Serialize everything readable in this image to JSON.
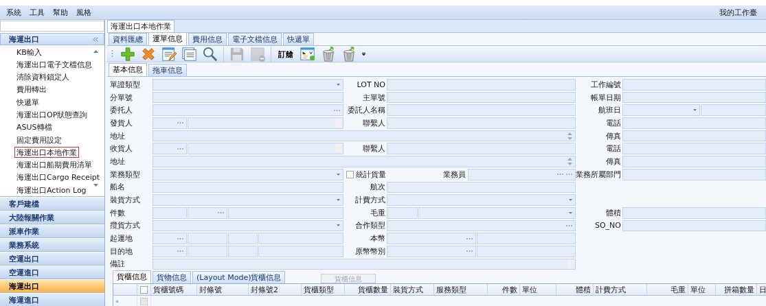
{
  "menu": [
    "系統",
    "工具",
    "幫助",
    "風格"
  ],
  "workbench": "我的工作臺",
  "sidebar": {
    "header": "海運出口",
    "items": [
      {
        "label": "KB輸入",
        "selected": false
      },
      {
        "label": "海運出口電子文檔信息",
        "selected": false
      },
      {
        "label": "清除資料鎖定人",
        "selected": false
      },
      {
        "label": "費用轉出",
        "selected": false
      },
      {
        "label": "快遞單",
        "selected": false
      },
      {
        "label": "海運出口OP狀態查詢",
        "selected": false
      },
      {
        "label": "ASUS轉檔",
        "selected": false
      },
      {
        "label": "固定費用設定",
        "selected": false
      },
      {
        "label": "海運出口本地作業",
        "selected": true
      },
      {
        "label": "海運出口船期費用清單",
        "selected": false
      },
      {
        "label": "海運出口Cargo Receipt",
        "selected": false
      },
      {
        "label": "海運出口Action Log",
        "selected": false
      }
    ],
    "groups": [
      {
        "label": "客戶建檔",
        "selected": false
      },
      {
        "label": "大陸報關作業",
        "selected": false
      },
      {
        "label": "派車作業",
        "selected": false
      },
      {
        "label": "業務系統",
        "selected": false
      },
      {
        "label": "空運出口",
        "selected": false
      },
      {
        "label": "空運進口",
        "selected": false
      },
      {
        "label": "海運出口",
        "selected": true
      },
      {
        "label": "海運進口",
        "selected": false
      }
    ]
  },
  "document_tab": "海運出口本地作業",
  "tabs": [
    {
      "label": "資料匯總",
      "selected": false
    },
    {
      "label": "運單信息",
      "selected": true
    },
    {
      "label": "費用信息",
      "selected": false
    },
    {
      "label": "電子文檔信息",
      "selected": false
    },
    {
      "label": "快遞單",
      "selected": false
    }
  ],
  "toolbar": [
    {
      "kind": "add",
      "disabled": false
    },
    {
      "kind": "delete",
      "disabled": false
    },
    {
      "kind": "edit",
      "disabled": false
    },
    {
      "kind": "list",
      "disabled": false
    },
    {
      "kind": "search",
      "disabled": false
    },
    {
      "kind": "save",
      "disabled": true
    },
    {
      "kind": "remove",
      "disabled": true
    },
    {
      "kind": "text",
      "label": "訂艙",
      "disabled": false
    },
    {
      "kind": "mail",
      "disabled": false
    },
    {
      "kind": "trash",
      "disabled": false
    },
    {
      "kind": "trash",
      "disabled": false
    }
  ],
  "subtabs": [
    {
      "label": "基本信息",
      "selected": true
    },
    {
      "label": "拖車信息",
      "selected": false
    }
  ],
  "form": [
    {
      "left": {
        "label": "單證類型",
        "segments": [
          {
            "kind": "combo"
          }
        ]
      },
      "middle": {
        "label": "LOT NO",
        "segments": [
          {
            "kind": "text"
          }
        ]
      },
      "right": {
        "label": "工作編號",
        "segments": [
          {
            "kind": "text"
          }
        ]
      }
    },
    {
      "left": {
        "label": "分單號",
        "segments": [
          {
            "kind": "text"
          }
        ]
      },
      "middle": {
        "label": "主單號",
        "segments": [
          {
            "kind": "text"
          }
        ]
      },
      "right": {
        "label": "帳單日期",
        "segments": [
          {
            "kind": "text"
          }
        ]
      }
    },
    {
      "left": {
        "label": "委托人",
        "segments": [
          {
            "kind": "lookup"
          }
        ]
      },
      "middle": {
        "label": "委託人名稱",
        "segments": [
          {
            "kind": "text"
          }
        ]
      },
      "right": {
        "label": "航班日",
        "segments": [
          {
            "kind": "combo"
          },
          {
            "kind": "text"
          }
        ]
      }
    },
    {
      "left": {
        "label": "發貨人",
        "segments": [
          {
            "kind": "lookup"
          },
          {
            "kind": "pick"
          }
        ]
      },
      "middle": {
        "label": "聯繫人",
        "segments": [
          {
            "kind": "text"
          }
        ]
      },
      "right": {
        "label": "電話",
        "segments": [
          {
            "kind": "text"
          }
        ]
      }
    },
    {
      "wide": {
        "label": "地址",
        "segments": [
          {
            "kind": "memo"
          }
        ]
      },
      "right": {
        "label": "傳真",
        "segments": [
          {
            "kind": "text"
          }
        ]
      }
    },
    {
      "left": {
        "label": "收貨人",
        "segments": [
          {
            "kind": "lookup"
          },
          {
            "kind": "pick"
          }
        ]
      },
      "middle": {
        "label": "聯繫人",
        "segments": [
          {
            "kind": "text"
          }
        ]
      },
      "right": {
        "label": "電話",
        "segments": [
          {
            "kind": "text"
          }
        ]
      }
    },
    {
      "wide": {
        "label": "地址",
        "segments": [
          {
            "kind": "memo"
          }
        ]
      },
      "right": {
        "label": "傳真",
        "segments": [
          {
            "kind": "text"
          }
        ]
      }
    },
    {
      "left": {
        "label": "業務類型",
        "segments": [
          {
            "kind": "combo"
          }
        ]
      },
      "check": {
        "check_label": "統計貨量",
        "checked": false,
        "label": "業務員"
      },
      "right": {
        "label": "業務所屬部門",
        "segments": [
          {
            "kind": "text"
          }
        ]
      }
    },
    {
      "left": {
        "label": "船名",
        "segments": [
          {
            "kind": "text"
          }
        ]
      },
      "middle": {
        "label": "航次",
        "segments": [
          {
            "kind": "text"
          }
        ]
      }
    },
    {
      "left": {
        "label": "裝貨方式",
        "segments": [
          {
            "kind": "combo"
          }
        ]
      },
      "middle": {
        "label": "計費方式",
        "segments": [
          {
            "kind": "combo"
          }
        ]
      }
    },
    {
      "left": {
        "label": "件數",
        "segments": [
          {
            "kind": "text"
          },
          {
            "kind": "lookup"
          },
          {
            "kind": "text"
          }
        ]
      },
      "middle": {
        "label": "毛重",
        "segments": [
          {
            "kind": "text"
          },
          {
            "kind": "combo"
          }
        ]
      },
      "right": {
        "label": "體積",
        "segments": [
          {
            "kind": "text"
          }
        ]
      }
    },
    {
      "left": {
        "label": "攬貨方式",
        "segments": [
          {
            "kind": "combo"
          }
        ]
      },
      "middle": {
        "label": "合作類型",
        "segments": [
          {
            "kind": "lookup"
          }
        ]
      },
      "right": {
        "label": "SO_NO",
        "segments": [
          {
            "kind": "text"
          }
        ]
      }
    },
    {
      "left": {
        "label": "起運地",
        "segments": [
          {
            "kind": "lookup"
          },
          {
            "kind": "text"
          },
          {
            "kind": "text"
          },
          {
            "kind": "text"
          }
        ]
      },
      "middle": {
        "label": "本幣",
        "segments": [
          {
            "kind": "lookup"
          },
          {
            "kind": "text"
          }
        ]
      }
    },
    {
      "left": {
        "label": "目的地",
        "segments": [
          {
            "kind": "lookup"
          },
          {
            "kind": "text"
          },
          {
            "kind": "text"
          },
          {
            "kind": "text"
          }
        ]
      },
      "middle": {
        "label": "原幣幣別",
        "segments": [
          {
            "kind": "lookup"
          },
          {
            "kind": "text"
          }
        ]
      }
    },
    {
      "wide": {
        "label": "備註",
        "segments": [
          {
            "kind": "pick"
          }
        ]
      }
    }
  ],
  "bottom_tabs": [
    {
      "label": "貨櫃信息",
      "selected": true
    },
    {
      "label": "貨物信息",
      "selected": false
    },
    {
      "label": "(Layout Mode)貨櫃信息",
      "selected": false
    }
  ],
  "bottom_button": {
    "label": "貨櫃信息",
    "disabled": true
  },
  "grid": {
    "select_all_checked": false,
    "rows": [
      {
        "checked": false
      }
    ],
    "columns": [
      {
        "label": "貨櫃號碼"
      },
      {
        "label": "封條號"
      },
      {
        "label": "封條號2"
      },
      {
        "label": "貨櫃類型"
      },
      {
        "label": "貨櫃數量"
      },
      {
        "label": "裝貨方式"
      },
      {
        "label": "服務類型"
      },
      {
        "label": "件數"
      },
      {
        "label": "單位"
      },
      {
        "label": "體積"
      },
      {
        "label": "計費方式"
      },
      {
        "label": "毛重"
      },
      {
        "label": "單位"
      },
      {
        "label": "拼箱數量"
      },
      {
        "label": "日"
      }
    ]
  }
}
